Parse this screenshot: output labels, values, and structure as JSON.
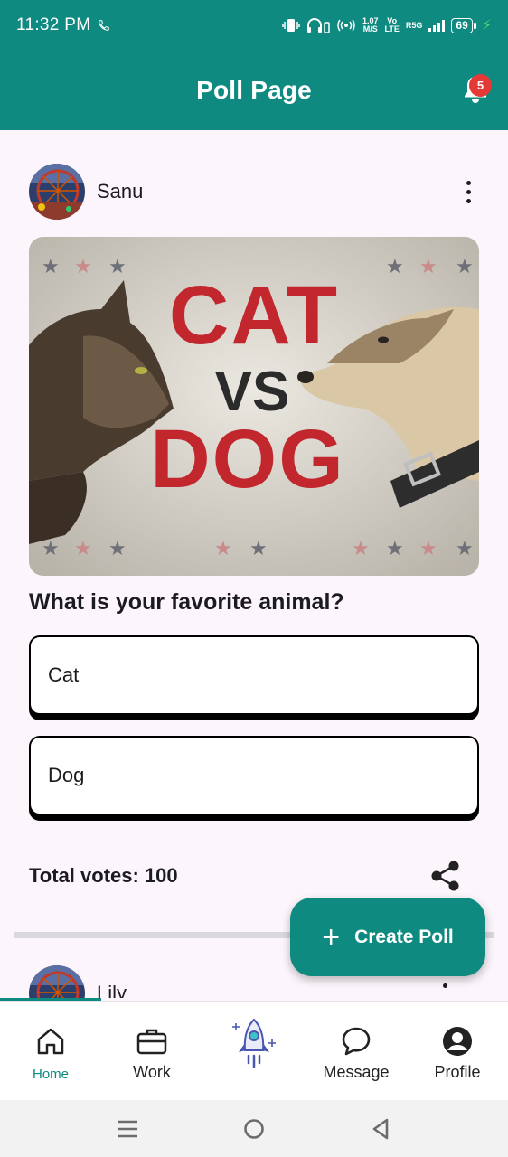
{
  "status_bar": {
    "time": "11:32 PM",
    "net_speed_top": "1.07",
    "net_speed_bottom": "M/S",
    "volte_top": "Vo",
    "volte_bottom": "LTE",
    "network": "R5G",
    "battery": "69"
  },
  "app_bar": {
    "title": "Poll Page",
    "notification_count": "5"
  },
  "post": {
    "username": "Sanu",
    "image_text": {
      "top": "CAT",
      "middle": "VS",
      "bottom": "DOG"
    },
    "question": "What is your favorite animal?",
    "options": [
      "Cat",
      "Dog"
    ],
    "total_votes": "Total votes: 100"
  },
  "post2": {
    "username": "Lily"
  },
  "fab": {
    "label": "Create Poll",
    "icon": "plus-icon"
  },
  "bottom_nav": {
    "items": [
      {
        "label": "Home",
        "icon": "home-icon",
        "active": true
      },
      {
        "label": "Work",
        "icon": "briefcase-icon",
        "active": false
      },
      {
        "label": "",
        "icon": "rocket-icon",
        "active": false
      },
      {
        "label": "Message",
        "icon": "chat-bubble-icon",
        "active": false
      },
      {
        "label": "Profile",
        "icon": "account-circle-icon",
        "active": false
      }
    ]
  },
  "colors": {
    "primary": "#0e8a80",
    "background": "#fcf6fc",
    "badge": "#e53935",
    "poster_red": "#c1272d"
  }
}
